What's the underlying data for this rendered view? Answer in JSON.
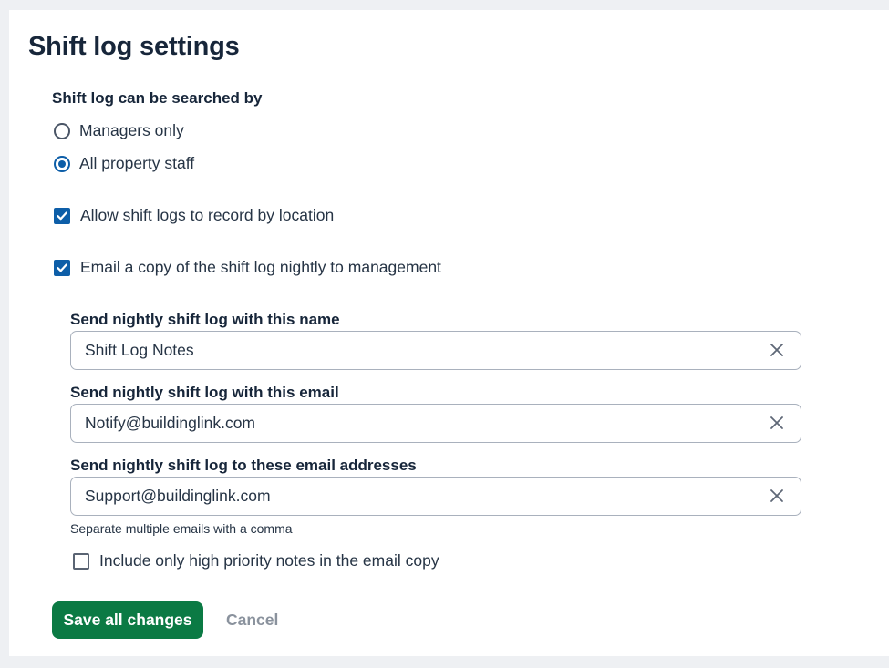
{
  "page": {
    "title": "Shift log settings"
  },
  "search": {
    "label": "Shift log can be searched by",
    "options": [
      {
        "label": "Managers only",
        "selected": false
      },
      {
        "label": "All property staff",
        "selected": true
      }
    ]
  },
  "options": {
    "record_by_location": {
      "label": "Allow shift logs to record by location",
      "checked": true
    },
    "email_nightly": {
      "label": "Email a copy of the shift log nightly to management",
      "checked": true
    }
  },
  "email_settings": {
    "name_field": {
      "label": "Send nightly shift log with this name",
      "value": "Shift Log Notes"
    },
    "from_field": {
      "label": "Send nightly shift log with this email",
      "value": "Notify@buildinglink.com"
    },
    "to_field": {
      "label": "Send nightly shift log to these email addresses",
      "value": "Support@buildinglink.com"
    },
    "hint": "Separate multiple emails with a comma",
    "high_priority": {
      "label": "Include only high priority notes in the email copy",
      "checked": false
    }
  },
  "actions": {
    "save_label": "Save all changes",
    "cancel_label": "Cancel"
  },
  "colors": {
    "primary": "#0d5ea8",
    "save": "#0b7a44",
    "background": "#eef0f3"
  }
}
